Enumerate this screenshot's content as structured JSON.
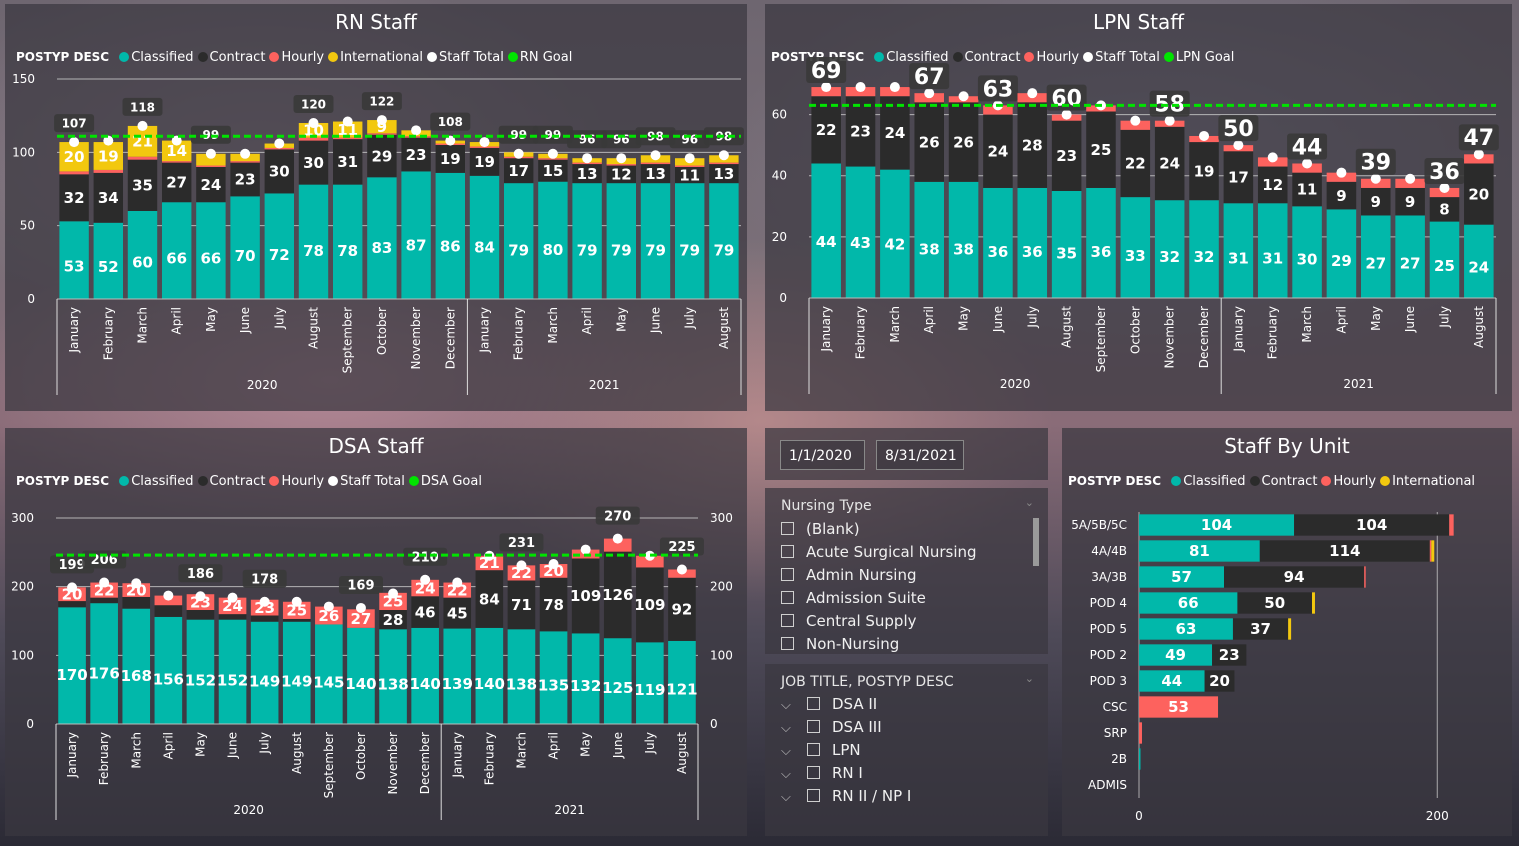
{
  "colors": {
    "classified": "#01b8aa",
    "contract": "#2b2b2b",
    "hourly": "#fd625e",
    "international": "#f2c80f",
    "total": "#ffffff",
    "goal": "#00e400"
  },
  "rn": {
    "title": "RN Staff",
    "legend_title": "POSTYP DESC",
    "legend": [
      {
        "name": "Classified",
        "color": "#01b8aa"
      },
      {
        "name": "Contract",
        "color": "#2b2b2b"
      },
      {
        "name": "Hourly",
        "color": "#fd625e"
      },
      {
        "name": "International",
        "color": "#f2c80f"
      },
      {
        "name": "Staff Total",
        "color": "#ffffff"
      },
      {
        "name": "RN Goal",
        "color": "#00e400"
      }
    ]
  },
  "lpn": {
    "title": "LPN Staff",
    "legend_title": "POSTYP DESC",
    "legend": [
      {
        "name": "Classified",
        "color": "#01b8aa"
      },
      {
        "name": "Contract",
        "color": "#2b2b2b"
      },
      {
        "name": "Hourly",
        "color": "#fd625e"
      },
      {
        "name": "Staff Total",
        "color": "#ffffff"
      },
      {
        "name": "LPN Goal",
        "color": "#00e400"
      }
    ]
  },
  "dsa": {
    "title": "DSA Staff",
    "legend_title": "POSTYP DESC",
    "legend": [
      {
        "name": "Classified",
        "color": "#01b8aa"
      },
      {
        "name": "Contract",
        "color": "#2b2b2b"
      },
      {
        "name": "Hourly",
        "color": "#fd625e"
      },
      {
        "name": "Staff Total",
        "color": "#ffffff"
      },
      {
        "name": "DSA Goal",
        "color": "#00e400"
      }
    ]
  },
  "unit": {
    "title": "Staff By Unit",
    "legend_title": "POSTYP DESC",
    "legend": [
      {
        "name": "Classified",
        "color": "#01b8aa"
      },
      {
        "name": "Contract",
        "color": "#2b2b2b"
      },
      {
        "name": "Hourly",
        "color": "#fd625e"
      },
      {
        "name": "International",
        "color": "#f2c80f"
      }
    ]
  },
  "filters": {
    "start_date": "1/1/2020",
    "end_date": "8/31/2021",
    "nursing_type_title": "Nursing Type",
    "nursing_types": [
      "(Blank)",
      "Acute Surgical Nursing",
      "Admin Nursing",
      "Admission Suite",
      "Central Supply",
      "Non-Nursing"
    ],
    "job_title_title": "JOB TITLE, POSTYP DESC",
    "job_titles": [
      "DSA II",
      "DSA III",
      "LPN",
      "RN I",
      "RN II / NP I"
    ]
  },
  "chart_data": [
    {
      "id": "rn",
      "type": "bar",
      "title": "RN Staff",
      "categories": [
        "January",
        "February",
        "March",
        "April",
        "May",
        "June",
        "July",
        "August",
        "September",
        "October",
        "November",
        "December",
        "January",
        "February",
        "March",
        "April",
        "May",
        "June",
        "July",
        "August"
      ],
      "years": [
        {
          "label": "2020",
          "count": 12
        },
        {
          "label": "2021",
          "count": 8
        }
      ],
      "series": [
        {
          "name": "Classified",
          "values": [
            53,
            52,
            60,
            66,
            66,
            70,
            72,
            78,
            78,
            83,
            87,
            86,
            84,
            79,
            80,
            79,
            79,
            79,
            79,
            79
          ]
        },
        {
          "name": "Contract",
          "values": [
            32,
            34,
            35,
            27,
            24,
            23,
            30,
            30,
            31,
            29,
            23,
            19,
            19,
            17,
            15,
            13,
            12,
            13,
            11,
            13
          ]
        },
        {
          "name": "Hourly",
          "values": [
            2,
            2,
            2,
            1,
            1,
            1,
            1,
            2,
            1,
            1,
            1,
            1,
            1,
            1,
            1,
            1,
            1,
            1,
            1,
            1
          ]
        },
        {
          "name": "International",
          "values": [
            20,
            19,
            21,
            14,
            8,
            5,
            3,
            10,
            11,
            9,
            4,
            2,
            3,
            3,
            3,
            3,
            4,
            5,
            5,
            5
          ]
        }
      ],
      "staff_total": [
        107,
        108,
        118,
        108,
        99,
        99,
        106,
        120,
        121,
        122,
        115,
        108,
        107,
        99,
        99,
        96,
        96,
        98,
        96,
        98
      ],
      "total_labels": [
        107,
        null,
        118,
        null,
        99,
        null,
        null,
        120,
        null,
        122,
        null,
        108,
        null,
        99,
        99,
        96,
        96,
        98,
        96,
        98
      ],
      "goal": 111,
      "show_totals_min": 4,
      "ylim": [
        0,
        150
      ],
      "yticks": [
        0,
        50,
        100,
        150
      ]
    },
    {
      "id": "lpn",
      "type": "bar",
      "title": "LPN Staff",
      "categories": [
        "January",
        "February",
        "March",
        "April",
        "May",
        "June",
        "July",
        "August",
        "September",
        "October",
        "November",
        "December",
        "January",
        "February",
        "March",
        "April",
        "May",
        "June",
        "July",
        "August"
      ],
      "years": [
        {
          "label": "2020",
          "count": 12
        },
        {
          "label": "2021",
          "count": 8
        }
      ],
      "series": [
        {
          "name": "Classified",
          "values": [
            44,
            43,
            42,
            38,
            38,
            36,
            36,
            35,
            36,
            33,
            32,
            32,
            31,
            31,
            30,
            29,
            27,
            27,
            25,
            24
          ]
        },
        {
          "name": "Contract",
          "values": [
            22,
            23,
            24,
            26,
            26,
            24,
            28,
            23,
            25,
            22,
            24,
            19,
            17,
            12,
            11,
            9,
            9,
            9,
            8,
            20
          ]
        },
        {
          "name": "Hourly",
          "values": [
            3,
            3,
            3,
            3,
            2,
            3,
            3,
            2,
            2,
            3,
            2,
            2,
            2,
            3,
            3,
            3,
            3,
            3,
            3,
            3
          ]
        }
      ],
      "staff_total": [
        69,
        69,
        69,
        67,
        66,
        63,
        67,
        60,
        63,
        58,
        58,
        53,
        50,
        46,
        44,
        41,
        39,
        39,
        36,
        47
      ],
      "total_labels": [
        69,
        null,
        null,
        67,
        null,
        63,
        null,
        60,
        null,
        null,
        58,
        null,
        50,
        null,
        44,
        null,
        39,
        null,
        36,
        47
      ],
      "goal": 63,
      "show_totals_min": 7,
      "ylim": [
        0,
        70
      ],
      "yticks": [
        0,
        20,
        40,
        60
      ]
    },
    {
      "id": "dsa",
      "type": "bar",
      "title": "DSA Staff",
      "categories": [
        "January",
        "February",
        "March",
        "April",
        "May",
        "June",
        "July",
        "August",
        "September",
        "October",
        "November",
        "December",
        "January",
        "February",
        "March",
        "April",
        "May",
        "June",
        "July",
        "August"
      ],
      "years": [
        {
          "label": "2020",
          "count": 12
        },
        {
          "label": "2021",
          "count": 8
        }
      ],
      "series": [
        {
          "name": "Classified",
          "values": [
            170,
            176,
            168,
            156,
            152,
            152,
            149,
            149,
            145,
            140,
            138,
            140,
            139,
            140,
            138,
            135,
            132,
            125,
            119,
            121
          ]
        },
        {
          "name": "Contract",
          "values": [
            9,
            8,
            17,
            17,
            14,
            8,
            9,
            4,
            0,
            0,
            28,
            46,
            45,
            84,
            71,
            78,
            109,
            126,
            109,
            92
          ]
        },
        {
          "name": "Hourly",
          "values": [
            20,
            22,
            20,
            14,
            23,
            24,
            23,
            25,
            26,
            27,
            25,
            24,
            22,
            21,
            22,
            20,
            13,
            19,
            17,
            12
          ]
        }
      ],
      "staff_total": [
        199,
        206,
        205,
        187,
        186,
        184,
        178,
        178,
        171,
        169,
        190,
        210,
        206,
        245,
        231,
        233,
        254,
        270,
        245,
        225
      ],
      "total_labels": [
        199,
        206,
        null,
        null,
        186,
        null,
        178,
        null,
        null,
        169,
        null,
        210,
        null,
        null,
        231,
        null,
        null,
        270,
        null,
        225
      ],
      "goal": 246,
      "show_totals_min": 20,
      "ylim": [
        0,
        300
      ],
      "yticks": [
        0,
        100,
        200,
        300
      ]
    },
    {
      "id": "unit",
      "type": "bar",
      "orientation": "horizontal",
      "title": "Staff By Unit",
      "categories": [
        "5A/5B/5C",
        "4A/4B",
        "3A/3B",
        "POD 4",
        "POD 5",
        "POD 2",
        "POD 3",
        "CSC",
        "SRP",
        "2B",
        "ADMIS"
      ],
      "series": [
        {
          "name": "Classified",
          "values": [
            104,
            81,
            57,
            66,
            63,
            49,
            44,
            0,
            0,
            1,
            0
          ]
        },
        {
          "name": "Contract",
          "values": [
            104,
            114,
            94,
            50,
            37,
            23,
            20,
            0,
            0,
            0,
            0
          ]
        },
        {
          "name": "Hourly",
          "values": [
            3,
            1,
            1,
            0,
            0,
            0,
            0,
            53,
            2,
            0,
            0
          ]
        },
        {
          "name": "International",
          "values": [
            0,
            2,
            0,
            2,
            2,
            0,
            0,
            0,
            0,
            0,
            0
          ]
        }
      ],
      "xlim": [
        0,
        230
      ],
      "xticks": [
        0,
        200
      ]
    }
  ]
}
